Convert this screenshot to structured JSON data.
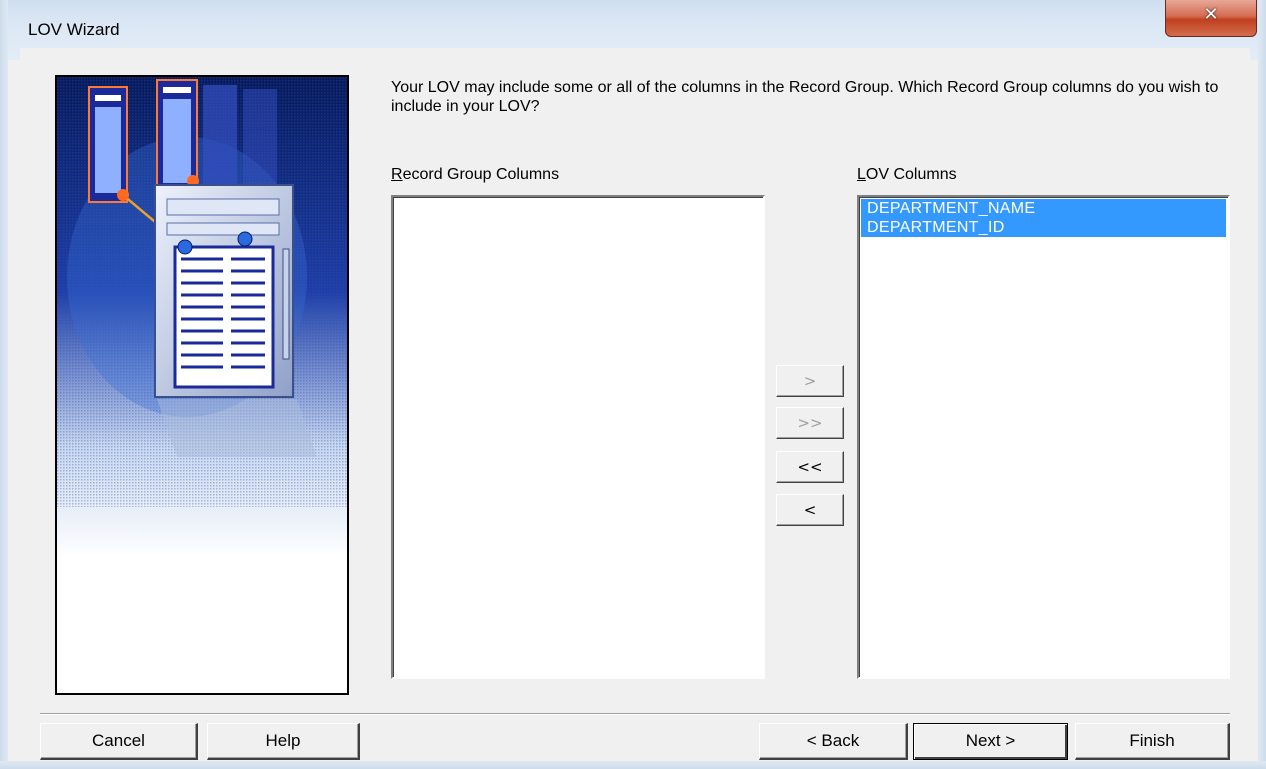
{
  "window": {
    "title": "LOV Wizard",
    "close_glyph": "✕"
  },
  "instruction": "Your LOV may include some or all of the columns in the Record Group. Which Record Group columns do you wish to include in your LOV?",
  "record_group": {
    "label_mnemonic": "R",
    "label_rest": "ecord Group Columns",
    "items": []
  },
  "lov_columns": {
    "label_mnemonic": "L",
    "label_rest": "OV Columns",
    "items": [
      "DEPARTMENT_NAME",
      "DEPARTMENT_ID"
    ]
  },
  "move_buttons": {
    "add_one": ">",
    "add_all": ">>",
    "remove_all": "<<",
    "remove_one": "<"
  },
  "footer": {
    "cancel": "Cancel",
    "help": "Help",
    "back": "< Back",
    "next": "Next >",
    "finish": "Finish"
  },
  "colors": {
    "selection": "#3399ff",
    "window_bg": "#f0f0f0",
    "close_button": "#c0401f"
  },
  "icons": [
    "close-icon",
    "wizard-illustration"
  ]
}
